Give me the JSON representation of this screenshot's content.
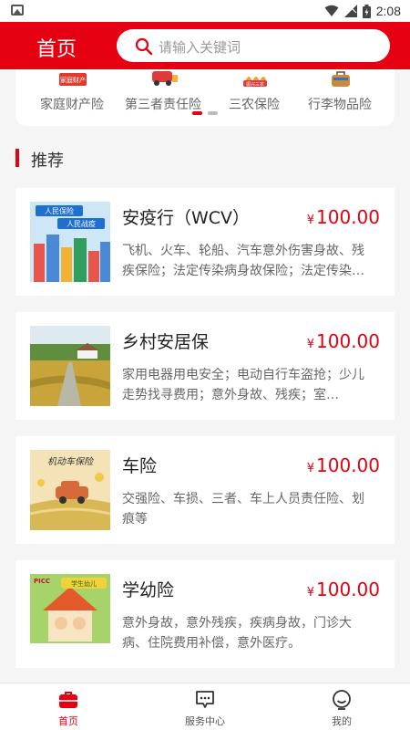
{
  "status_bar": {
    "time": "2:08"
  },
  "header": {
    "title": "首页",
    "search_placeholder": "请输入关键词"
  },
  "categories": [
    {
      "label": "家庭财产险",
      "icon": "house-property-icon",
      "banner": "家庭财产"
    },
    {
      "label": "第三者责任险",
      "icon": "vehicle-accident-icon"
    },
    {
      "label": "三农保险",
      "icon": "agriculture-icon",
      "banner": "振兴三农"
    },
    {
      "label": "行李物品险",
      "icon": "luggage-icon"
    }
  ],
  "carousel": {
    "pages": 2,
    "active": 0
  },
  "section": {
    "title": "推荐"
  },
  "products": [
    {
      "name": "安疫行（WCV）",
      "currency": "¥",
      "price": "100.00",
      "desc": "飞机、火车、轮船、汽车意外伤害身故、残疾保险；法定传染病身故保险；法定传染病…",
      "thumb_text_1": "人民保险",
      "thumb_text_2": "人民战疫"
    },
    {
      "name": "乡村安居保",
      "currency": "¥",
      "price": "100.00",
      "desc": "家用电器用电安全；电动自行车盗抢；少儿走势找寻费用；意外身故、残疾；室…"
    },
    {
      "name": "车险",
      "currency": "¥",
      "price": "100.00",
      "desc": "交强险、车损、三者、车上人员责任险、划痕等",
      "thumb_text_1": "机动车保险"
    },
    {
      "name": "学幼险",
      "currency": "¥",
      "price": "100.00",
      "desc": "意外身故，意外残疾，疾病身故，门诊大病、住院费用补偿，意外医疗。",
      "thumb_text_1": "PICC",
      "thumb_text_2": "学生幼儿"
    }
  ],
  "tabbar": [
    {
      "label": "首页",
      "icon": "toolbox-icon",
      "active": true
    },
    {
      "label": "服务中心",
      "icon": "chat-icon",
      "active": false
    },
    {
      "label": "我的",
      "icon": "user-icon",
      "active": false
    }
  ],
  "colors": {
    "brand": "#e50012",
    "background": "#f5f5f5"
  }
}
